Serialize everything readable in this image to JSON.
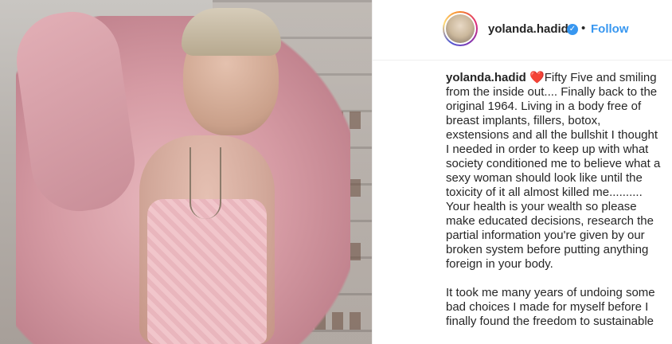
{
  "post": {
    "image_alt": "photo of woman in pink shirt and lace bodysuit in a closet"
  },
  "header": {
    "username": "yolanda.hadid",
    "verified_symbol": "✓",
    "separator": "•",
    "follow_label": "Follow",
    "accent_color": "#3897f0"
  },
  "caption": {
    "username": "yolanda.hadid",
    "heart": "❤️",
    "paragraph1": "Fifty Five and smiling from the inside out.... Finally back to the original 1964. Living in a body free of breast implants, fillers, botox, exstensions and all the bullshit I thought I needed in order to keep up with what society conditioned me to believe what a sexy woman should look like until the toxicity of it all almost killed me.......... Your health is your wealth so please make educated decisions, research the partial information you're given by our broken system before putting anything foreign in your body.",
    "paragraph2": "It took me many years of undoing some bad choices I made for myself before I finally found the freedom to sustainable"
  }
}
